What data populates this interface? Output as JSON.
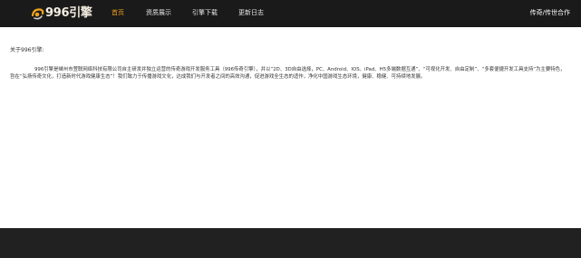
{
  "header": {
    "logo_text": "996引擎",
    "nav": [
      {
        "label": "首页",
        "active": true
      },
      {
        "label": "资质展示",
        "active": false
      },
      {
        "label": "引擎下载",
        "active": false
      },
      {
        "label": "更新日志",
        "active": false
      }
    ],
    "right_link": "传奇/传世合作"
  },
  "main": {
    "heading": "关于996引擎:",
    "paragraph": "996引擎是嵊州市萱联网络科技有限公司自主研发并独立运营的传奇游戏开发服务工具（996传奇引擎），并以“2D、3D自由选择，PC、Android、IOS、iPad、H5多端数据互通”、“可视化开发、自由定制”、“多套便捷开发工具支持”为主要特色，旨在“弘扬传奇文化，打造新时代游戏健康生态”！我们致力于传播游戏文化，达成我们与开发者之间的高效沟通，促进游戏全生态的适作，净化中国游戏生态环境，健康、稳健、可持续地发展。"
  },
  "colors": {
    "header_bg": "#1a1a1a",
    "active_nav": "#f0a21c",
    "content_bg": "#ffffff",
    "footer_bg": "#212121"
  },
  "icons": {
    "logo": "swirl-logo-icon"
  }
}
